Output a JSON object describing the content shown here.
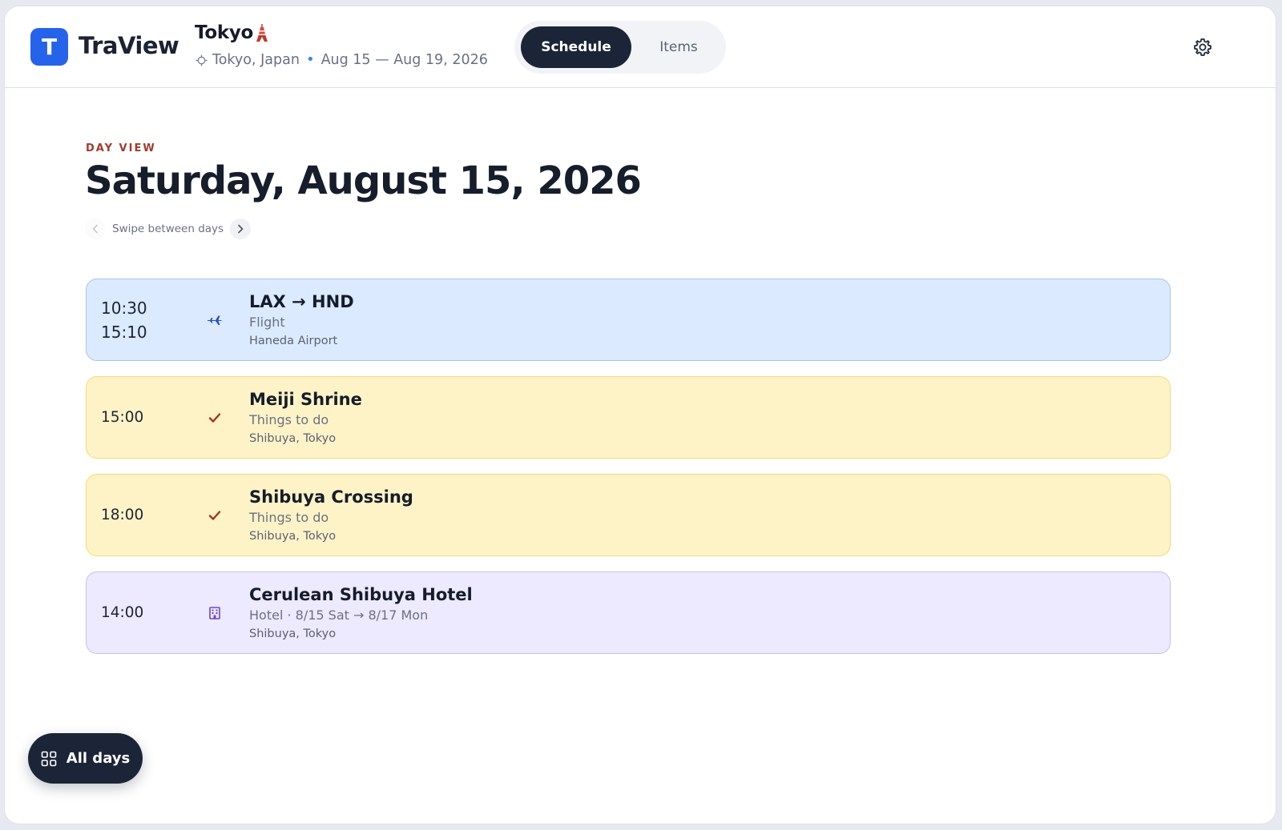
{
  "app": {
    "logo_letter": "T",
    "name": "TraView"
  },
  "trip": {
    "title": "Tokyo",
    "location": "Tokyo, Japan",
    "separator": "•",
    "dates": "Aug 15 — Aug 19, 2026"
  },
  "tabs": [
    {
      "label": "Schedule",
      "active": true
    },
    {
      "label": "Items",
      "active": false
    }
  ],
  "day": {
    "eyebrow": "DAY VIEW",
    "title": "Saturday, August 15, 2026",
    "swipe_hint": "Swipe between days"
  },
  "events": [
    {
      "type": "flight",
      "icon": "airplane-icon",
      "start": "10:30",
      "end": "15:10",
      "title": "LAX → HND",
      "subtitle": "Flight",
      "location": "Haneda Airport",
      "color": "#dbeafe"
    },
    {
      "type": "todo",
      "icon": "check-icon",
      "start": "15:00",
      "title": "Meiji Shrine",
      "subtitle": "Things to do",
      "location": "Shibuya, Tokyo",
      "color": "#fef3c7"
    },
    {
      "type": "todo",
      "icon": "check-icon",
      "start": "18:00",
      "title": "Shibuya Crossing",
      "subtitle": "Things to do",
      "location": "Shibuya, Tokyo",
      "color": "#fef3c7"
    },
    {
      "type": "hotel",
      "icon": "building-icon",
      "start": "14:00",
      "title": "Cerulean Shibuya Hotel",
      "subtitle": "Hotel · 8/15 Sat → 8/17 Mon",
      "location": "Shibuya, Tokyo",
      "color": "#ede9fe"
    }
  ],
  "fab": {
    "label": "All days",
    "icon": "grid-icon"
  },
  "colors": {
    "accent": "#2563eb",
    "dark": "#1c2537",
    "eyebrow": "#a23a2b"
  }
}
